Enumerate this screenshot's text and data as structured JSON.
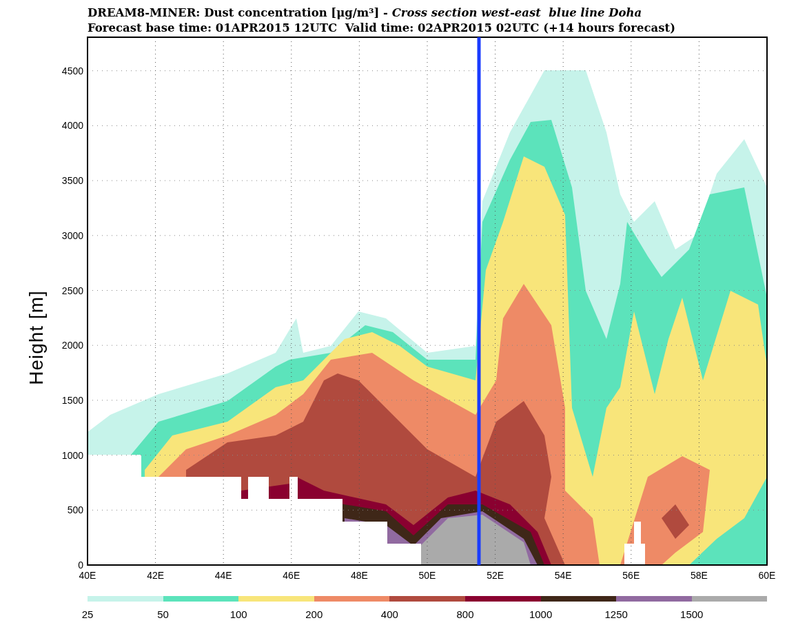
{
  "title": {
    "line_1": "DREAM8-MINER: Dust concentration [μg/m³] - *Cross section west-east  blue line Doha*",
    "line_2": "Forecast base time: 01APR2015 12UTC  Valid time: 02APR2015 02UTC (+14 hours forecast)"
  },
  "y_axis": {
    "label": "Height [m]",
    "ticks": [
      "4500",
      "4000",
      "3500",
      "3000",
      "2500",
      "2000",
      "1500",
      "1000",
      "500",
      "0"
    ]
  },
  "x_axis": {
    "ticks": [
      "40E",
      "42E",
      "44E",
      "46E",
      "48E",
      "50E",
      "52E",
      "54E",
      "56E",
      "58E",
      "60E"
    ]
  },
  "colorbar": [
    {
      "label": "25",
      "color": "#c6f3ea"
    },
    {
      "label": "50",
      "color": "#5ce3bb"
    },
    {
      "label": "100",
      "color": "#f8e57a"
    },
    {
      "label": "200",
      "color": "#ee8a66"
    },
    {
      "label": "400",
      "color": "#b04a3e"
    },
    {
      "label": "800",
      "color": "#8a0030"
    },
    {
      "label": "1000",
      "color": "#3f2718"
    },
    {
      "label": "1250",
      "color": "#916aa0"
    },
    {
      "label": "1500",
      "color": "#aaaaaa"
    }
  ]
}
